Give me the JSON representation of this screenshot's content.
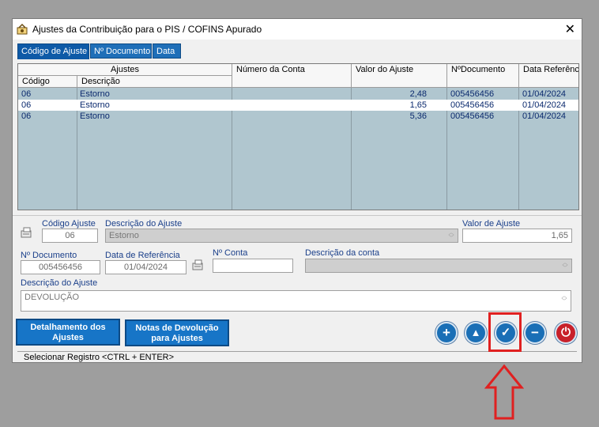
{
  "window": {
    "title": "Ajustes da Contribuição para o PIS / COFINS Apurado",
    "close_label": "✕"
  },
  "tabs": [
    {
      "label": "Código de Ajuste",
      "active": true
    },
    {
      "label": "Nº Documento",
      "active": false
    },
    {
      "label": "Data",
      "active": false
    }
  ],
  "grid": {
    "group_header": "Ajustes",
    "headers": {
      "codigo": "Código",
      "descricao": "Descrição",
      "numero_conta": "Número da Conta",
      "valor_ajuste": "Valor do Ajuste",
      "n_documento": "NºDocumento",
      "data_referencia": "Data Referênc"
    },
    "rows": [
      {
        "codigo": "06",
        "descricao": "Estorno",
        "numero_conta": "",
        "valor": "2,48",
        "documento": "005456456",
        "data": "01/04/2024",
        "selected": false
      },
      {
        "codigo": "06",
        "descricao": "Estorno",
        "numero_conta": "",
        "valor": "1,65",
        "documento": "005456456",
        "data": "01/04/2024",
        "selected": true
      },
      {
        "codigo": "06",
        "descricao": "Estorno",
        "numero_conta": "",
        "valor": "5,36",
        "documento": "005456456",
        "data": "01/04/2024",
        "selected": false
      }
    ]
  },
  "form": {
    "codigo_ajuste_label": "Código Ajuste",
    "codigo_ajuste_value": "06",
    "descricao_ajuste_label": "Descrição do Ajuste",
    "descricao_ajuste_value": "Estorno",
    "valor_ajuste_label": "Valor de Ajuste",
    "valor_ajuste_value": "1,65",
    "n_documento_label": "Nº Documento",
    "n_documento_value": "005456456",
    "data_referencia_label": "Data de Referência",
    "data_referencia_value": "01/04/2024",
    "n_conta_label": "Nº Conta",
    "n_conta_value": "",
    "descricao_conta_label": "Descrição da conta",
    "descricao_conta_value": "",
    "descricao_ajuste_memo_label": "Descrição do Ajuste",
    "descricao_ajuste_memo_value": "DEVOLUÇÃO"
  },
  "buttons": {
    "detalhamento": "Detalhamento dos Ajustes",
    "notas_devolucao": "Notas de Devolução para Ajustes"
  },
  "action_icons": [
    "add-icon",
    "up-icon",
    "check-icon",
    "remove-icon",
    "power-icon"
  ],
  "status": {
    "text": "Selecionar Registro  <CTRL + ENTER>"
  },
  "colors": {
    "accent": "#1775c7",
    "grid_bg": "#b0c6cf",
    "highlight": "#e02020"
  }
}
